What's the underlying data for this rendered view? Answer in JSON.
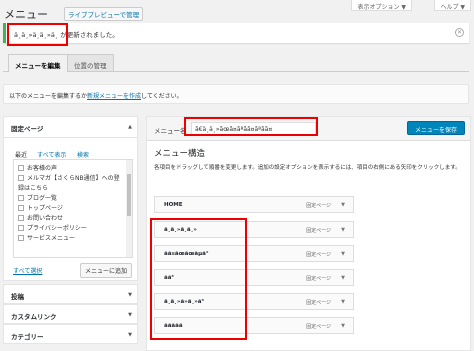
{
  "screen_options": "表示オプション ▼",
  "help": "ヘルプ ▼",
  "page_title": "メニュー",
  "live_preview_button": "ライブプレビューで管理",
  "notice": {
    "prefix": "ä¸ä¸»ä¸ä¸»ä¸",
    "text": " が更新されました。",
    "dismiss": "✕"
  },
  "tabs": [
    "メニューを編集",
    "位置の管理"
  ],
  "info": {
    "before": "以下のメニューを編集するか",
    "link": "新規メニューを作成",
    "after": "してください。"
  },
  "sidebar": {
    "fixed_page": {
      "title": "固定ページ",
      "subtabs": [
        "最近",
        "すべて表示",
        "検索"
      ],
      "items": [
        "お客様の声",
        "メルマガ【さくらNB通信】への登",
        "録はこちら",
        "ブログ一覧",
        "トップページ",
        "お問い合わせ",
        "プライバシーポリシー",
        "サービスメニュー"
      ],
      "select_all": "すべて選択",
      "add_button": "メニューに追加"
    },
    "accordions": [
      "投稿",
      "カスタムリンク",
      "カテゴリー"
    ]
  },
  "menu_name": {
    "label": "メニュー名",
    "value": "ã€ä¸ä¸»ãœã¤ãªãã¤ãªãã¤"
  },
  "save_button": "メニューを保存",
  "structure": {
    "title": "メニュー構造",
    "desc": "各項目をドラッグして順番を変更します。追加の設定オプションを表示するには、項目の右側にある矢印をクリックします。",
    "items": [
      {
        "label": "HOME",
        "type": "固定ページ"
      },
      {
        "label": "ä¸ä¸»ä¸ä¸»",
        "type": "固定ページ"
      },
      {
        "label": "ãã¤ãœãœãµã°",
        "type": "固定ページ"
      },
      {
        "label": "ãã³",
        "type": "固定ページ"
      },
      {
        "label": "ä¸ä¸»ã»ä¸»ã³",
        "type": "固定ページ"
      },
      {
        "label": "ããããã",
        "type": "固定ページ"
      }
    ],
    "dropdown_icon": "▼"
  }
}
